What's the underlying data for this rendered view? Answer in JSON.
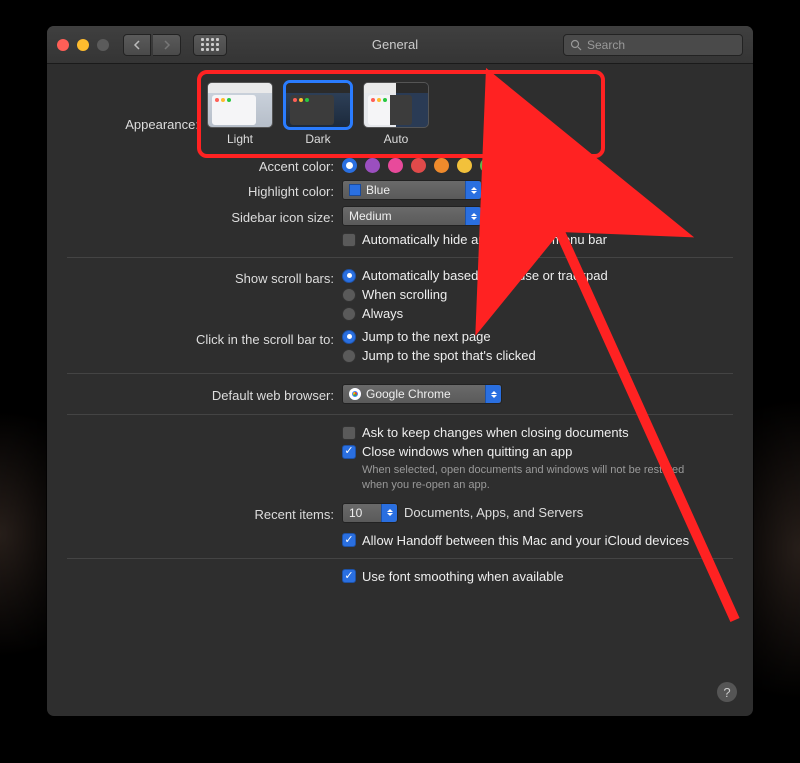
{
  "window": {
    "title": "General"
  },
  "search": {
    "placeholder": "Search"
  },
  "appearance": {
    "label": "Appearance:",
    "options": {
      "light": "Light",
      "dark": "Dark",
      "auto": "Auto"
    },
    "selected": "dark"
  },
  "accent": {
    "label": "Accent color:",
    "colors": [
      "#2a6fe0",
      "#9b4fbf",
      "#e84a9b",
      "#e04a4a",
      "#ef8a2c",
      "#f2c13b",
      "#5fb84d",
      "#8e8e93"
    ],
    "selected_index": 0
  },
  "highlight": {
    "label": "Highlight color:",
    "value": "Blue"
  },
  "sidebar_size": {
    "label": "Sidebar icon size:",
    "value": "Medium"
  },
  "autohide_menubar": {
    "label": "Automatically hide and show the menu bar",
    "checked": false
  },
  "scrollbars": {
    "label": "Show scroll bars:",
    "options": {
      "auto": "Automatically based on mouse or trackpad",
      "scrolling": "When scrolling",
      "always": "Always"
    },
    "selected": "auto"
  },
  "click_scroll": {
    "label": "Click in the scroll bar to:",
    "options": {
      "next": "Jump to the next page",
      "spot": "Jump to the spot that's clicked"
    },
    "selected": "next"
  },
  "default_browser": {
    "label": "Default web browser:",
    "value": "Google Chrome"
  },
  "ask_changes": {
    "label": "Ask to keep changes when closing documents",
    "checked": false
  },
  "close_windows": {
    "label": "Close windows when quitting an app",
    "checked": true,
    "helper": "When selected, open documents and windows will not be restored when you re-open an app."
  },
  "recent": {
    "label": "Recent items:",
    "value": "10",
    "suffix": "Documents, Apps, and Servers"
  },
  "handoff": {
    "label": "Allow Handoff between this Mac and your iCloud devices",
    "checked": true
  },
  "font_smoothing": {
    "label": "Use font smoothing when available",
    "checked": true
  }
}
